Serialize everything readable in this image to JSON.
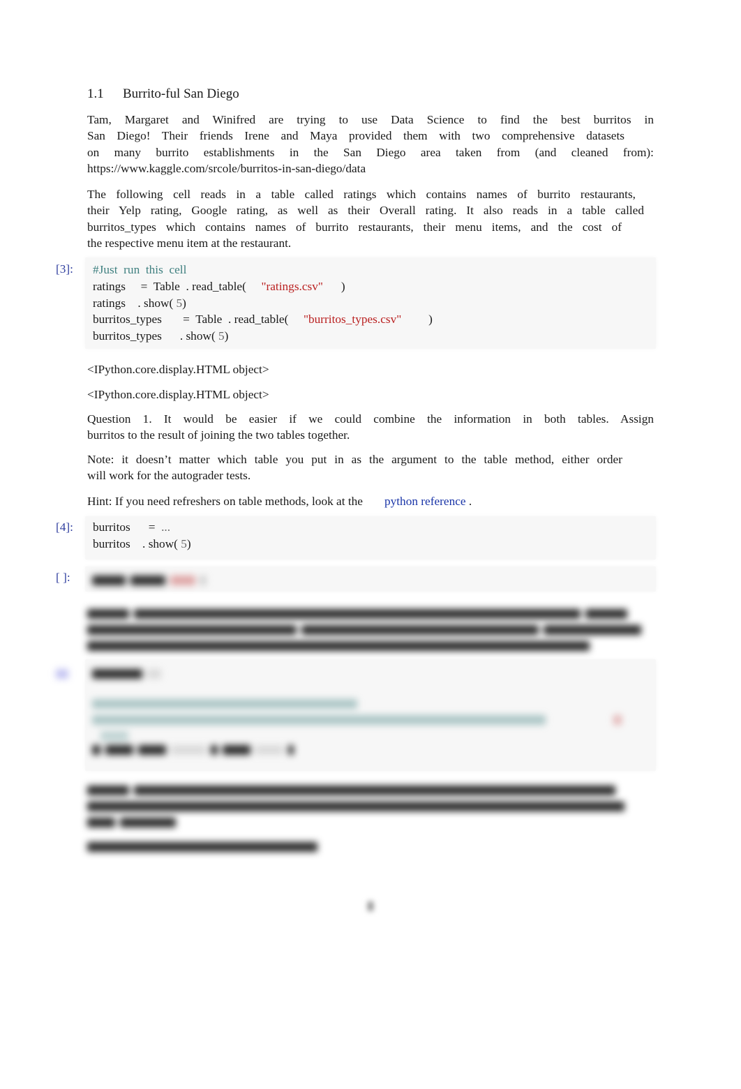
{
  "section": {
    "number": "1.1",
    "title": "Burrito-ful San Diego"
  },
  "intro": {
    "lines": [
      "Tam,  Margaret  and  Winifred  are  trying  to  use  Data  Science  to  find  the  best  burritos  in",
      "San Diego!   Their friends Irene and Maya provided them with two comprehensive datasets",
      "on  many  burrito  establishments  in  the  San  Diego  area  taken  from  (and  cleaned  from):",
      "https://www.kaggle.com/srcole/burritos-in-san-diego/data"
    ]
  },
  "description": {
    "lines": [
      "The following cell reads in a table called    ratings    which contains names of burrito restaurants,",
      "their Yelp rating, Google rating, as well as their Overall rating.        It also reads in a table called",
      "burritos_types       which contains names of burrito restaurants, their menu items, and the cost of",
      "the respective menu item at the restaurant."
    ]
  },
  "cell3": {
    "prompt": "[3]:",
    "comment": "#Just  run  this  cell",
    "line2": {
      "var": "ratings",
      "assign": "     =  Table  . read_table(     ",
      "string": "\"ratings.csv\"",
      "end": "      )"
    },
    "line3": {
      "var": "ratings",
      "call": "    . show( ",
      "num": "5",
      "end": ")"
    },
    "line4": {
      "var": "burritos_types",
      "assign": "       =  Table  . read_table(     ",
      "string": "\"burritos_types.csv\"",
      "end": "         )"
    },
    "line5": {
      "var": "burritos_types",
      "call": "      . show( ",
      "num": "5",
      "end": ")"
    }
  },
  "outputs": [
    "<IPython.core.display.HTML  object>",
    "<IPython.core.display.HTML  object>"
  ],
  "question1": {
    "line1": "Question  1.      It  would  be  easier  if  we  could  combine  the  information  in  both  tables.        Assign",
    "line2": "burritos     to the result of joining the two tables together."
  },
  "note": {
    "line1": "Note: it doesn’t matter which table you put in as the argument to the table method, either order",
    "line2": "will work for the autograder tests."
  },
  "hint": {
    "prefix": "Hint: If you need refreshers on table methods, look at the",
    "link": "python reference",
    "suffix": " ."
  },
  "cell4": {
    "prompt": "[4]:",
    "line1": {
      "var": "burritos",
      "assign": "      =  ",
      "dots": "..."
    },
    "line2": {
      "var": "burritos",
      "call": "    . show( ",
      "num": "5",
      "end": ")"
    }
  },
  "cell_empty": {
    "prompt": "[ ]:"
  },
  "blurred_notice": "Content below is blurred / obscured"
}
